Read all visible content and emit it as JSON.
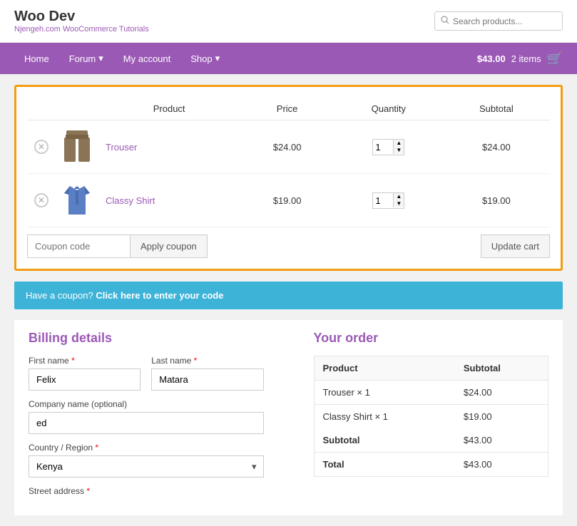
{
  "header": {
    "title": "Woo Dev",
    "subtitle": "Njengeh.com WooCommerce Tutorials",
    "subtitle_link_text": "Njengeh.com WooCommerce Tutorials",
    "search_placeholder": "Search products..."
  },
  "nav": {
    "items": [
      {
        "label": "Home",
        "has_dropdown": false
      },
      {
        "label": "Forum",
        "has_dropdown": true
      },
      {
        "label": "My account",
        "has_dropdown": false
      },
      {
        "label": "Shop",
        "has_dropdown": true
      }
    ],
    "cart": {
      "amount": "$43.00",
      "count": "2 items"
    }
  },
  "cart": {
    "columns": [
      "Product",
      "Price",
      "Quantity",
      "Subtotal"
    ],
    "items": [
      {
        "id": 1,
        "name": "Trouser",
        "price": "$24.00",
        "quantity": 1,
        "subtotal": "$24.00"
      },
      {
        "id": 2,
        "name": "Classy Shirt",
        "price": "$19.00",
        "quantity": 1,
        "subtotal": "$19.00"
      }
    ],
    "coupon_placeholder": "Coupon code",
    "apply_coupon_label": "Apply coupon",
    "update_cart_label": "Update cart"
  },
  "coupon_notice": {
    "text": "Have a coupon?",
    "link_text": "Click here to enter your code"
  },
  "billing": {
    "title": "Billing details",
    "first_name_label": "First name",
    "last_name_label": "Last name",
    "first_name_value": "Felix",
    "last_name_value": "Matara",
    "company_label": "Company name (optional)",
    "company_value": "ed",
    "country_label": "Country / Region",
    "country_value": "Kenya",
    "street_label": "Street address"
  },
  "your_order": {
    "title": "Your order",
    "columns": [
      "Product",
      "Subtotal"
    ],
    "items": [
      {
        "name": "Trouser × 1",
        "subtotal": "$24.00"
      },
      {
        "name": "Classy Shirt × 1",
        "subtotal": "$19.00"
      }
    ],
    "subtotal_label": "Subtotal",
    "subtotal_value": "$43.00",
    "total_label": "Total",
    "total_value": "$43.00"
  },
  "colors": {
    "purple": "#9b59b6",
    "orange": "#f39c12",
    "teal": "#3db3d8"
  }
}
